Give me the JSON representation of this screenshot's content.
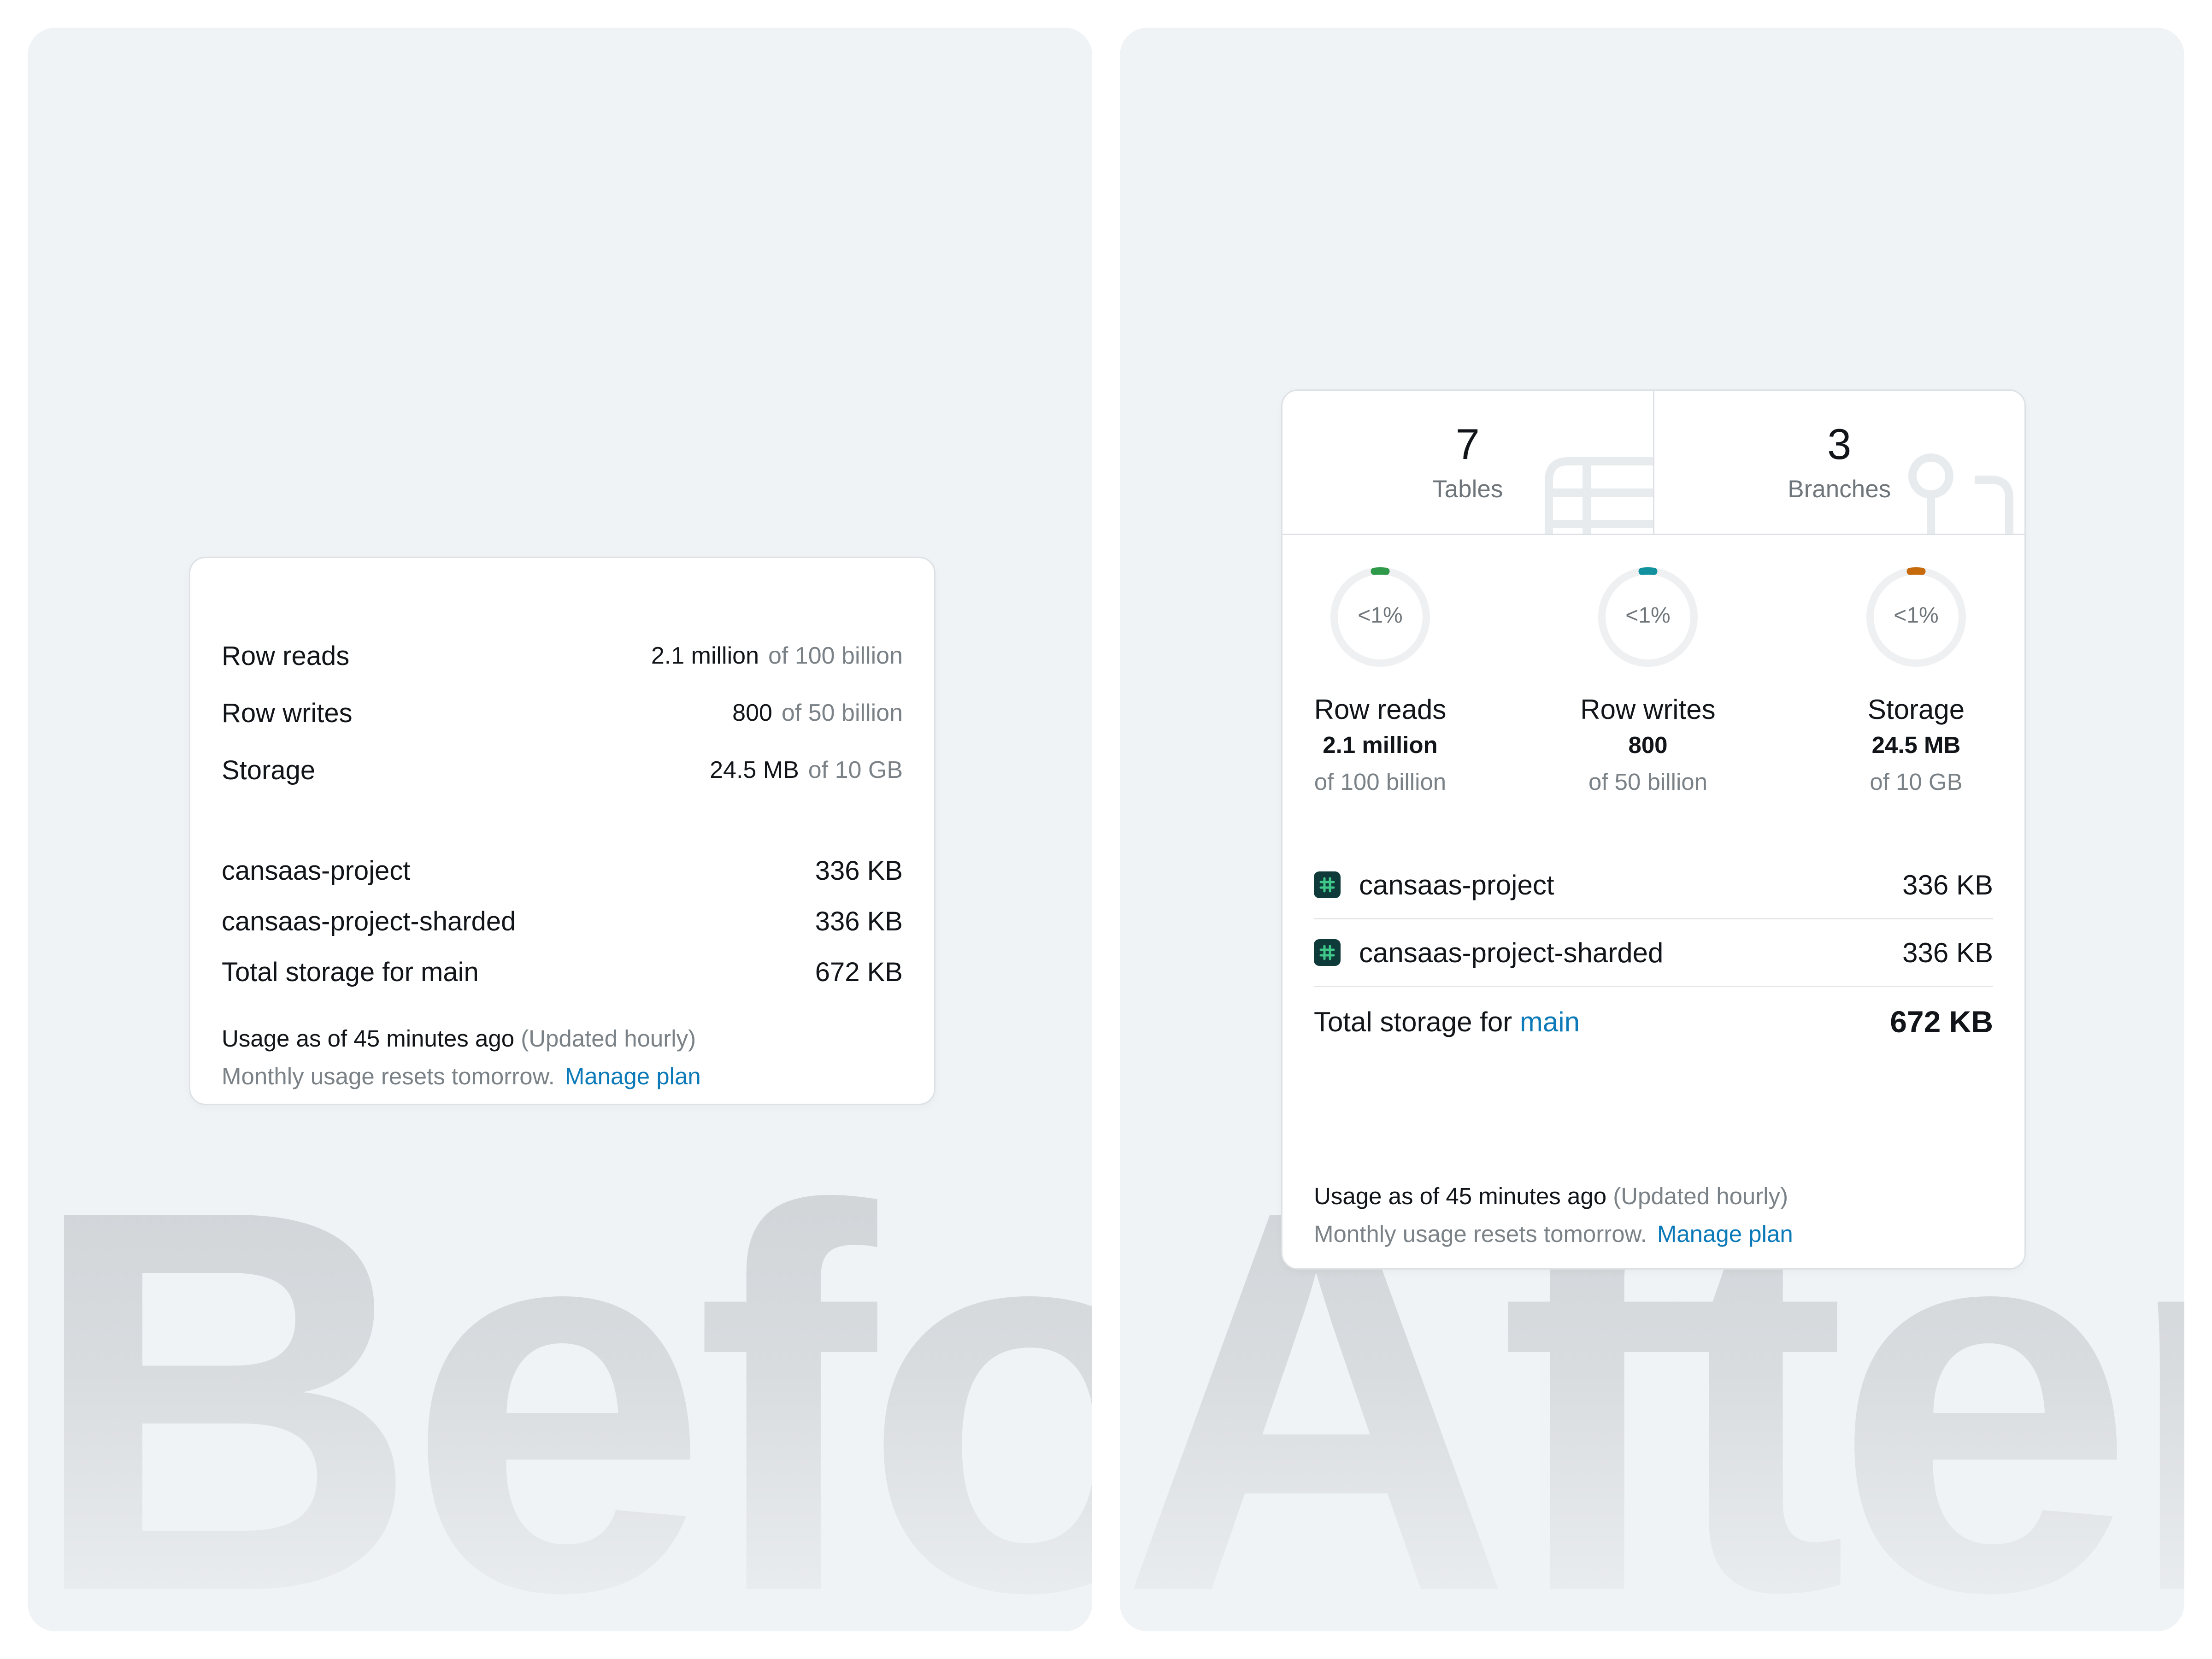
{
  "before": {
    "watermark": "Before",
    "usage": [
      {
        "label": "Row reads",
        "value": "2.1 million",
        "limit": "of 100 billion"
      },
      {
        "label": "Row writes",
        "value": "800",
        "limit": "of 50 billion"
      },
      {
        "label": "Storage",
        "value": "24.5 MB",
        "limit": "of 10 GB"
      }
    ],
    "databases": [
      {
        "name": "cansaas-project",
        "size": "336 KB"
      },
      {
        "name": "cansaas-project-sharded",
        "size": "336 KB"
      }
    ],
    "total_label": "Total storage for main",
    "total_value": "672 KB",
    "footer": {
      "usage_as_of": "Usage as of 45 minutes ago",
      "updated": "(Updated hourly)",
      "resets": "Monthly usage resets tomorrow.",
      "manage_plan": "Manage plan"
    }
  },
  "after": {
    "watermark": "After",
    "stats": [
      {
        "value": "7",
        "label": "Tables"
      },
      {
        "value": "3",
        "label": "Branches"
      }
    ],
    "metrics": [
      {
        "percent_label": "<1%",
        "label": "Row reads",
        "value": "2.1 million",
        "limit": "of 100 billion",
        "fraction": 0.01,
        "color": "#2e9a4a"
      },
      {
        "percent_label": "<1%",
        "label": "Row writes",
        "value": "800",
        "limit": "of 50 billion",
        "fraction": 0.01,
        "color": "#11929e"
      },
      {
        "percent_label": "<1%",
        "label": "Storage",
        "value": "24.5 MB",
        "limit": "of 10 GB",
        "fraction": 0.01,
        "color": "#c76a0b"
      }
    ],
    "databases": [
      {
        "name": "cansaas-project",
        "size": "336 KB",
        "icon": "database-icon"
      },
      {
        "name": "cansaas-project-sharded",
        "size": "336 KB",
        "icon": "database-icon"
      }
    ],
    "total_label": "Total storage for",
    "total_branch": "main",
    "total_value": "672 KB",
    "footer": {
      "usage_as_of": "Usage as of 45 minutes ago",
      "updated": "(Updated hourly)",
      "resets": "Monthly usage resets tomorrow.",
      "manage_plan": "Manage plan"
    }
  },
  "colors": {
    "link": "#0c7ab8",
    "panel_background": "#f0f3f5",
    "db_icon_background": "#0e3b3a",
    "db_icon_accent": "#3fc88a"
  }
}
